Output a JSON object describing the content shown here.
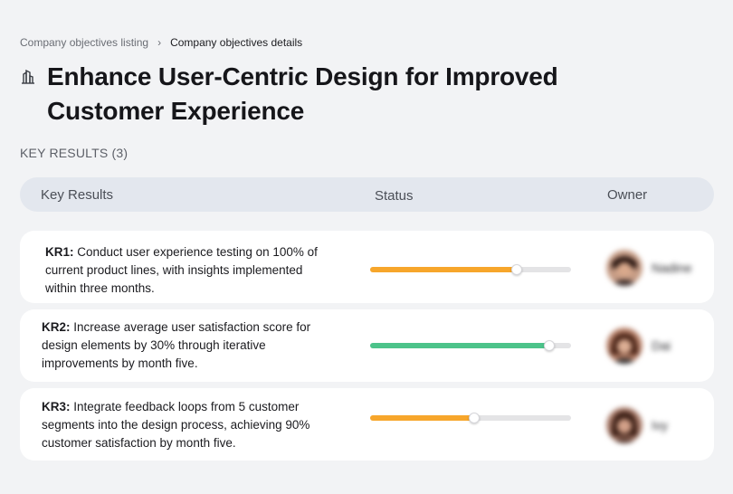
{
  "breadcrumb": {
    "parent": "Company objectives listing",
    "current": "Company objectives details"
  },
  "page": {
    "title": "Enhance User-Centric Design for Improved Customer Experience",
    "title_icon": "building-icon"
  },
  "key_results_label": "KEY RESULTS (3)",
  "table": {
    "headers": {
      "key_results": "Key Results",
      "status": "Status",
      "owner": "Owner"
    }
  },
  "key_results": [
    {
      "id": "KR1:",
      "text": " Conduct user experience testing on 100% of current product lines, with insights implemented within three months.",
      "progress": 0.73,
      "color": "#f7a62b",
      "owner": "Nadine"
    },
    {
      "id": "KR2:",
      "text": " Increase average user satisfaction score for design elements by 30% through iterative improvements by month five.",
      "progress": 0.89,
      "color": "#4cc38a",
      "owner": "Dai"
    },
    {
      "id": "KR3:",
      "text": " Integrate feedback loops from 5 customer segments into the design process, achieving 90% customer satisfaction by month five.",
      "progress": 0.52,
      "color": "#f7a62b",
      "owner": "Ivy"
    }
  ]
}
